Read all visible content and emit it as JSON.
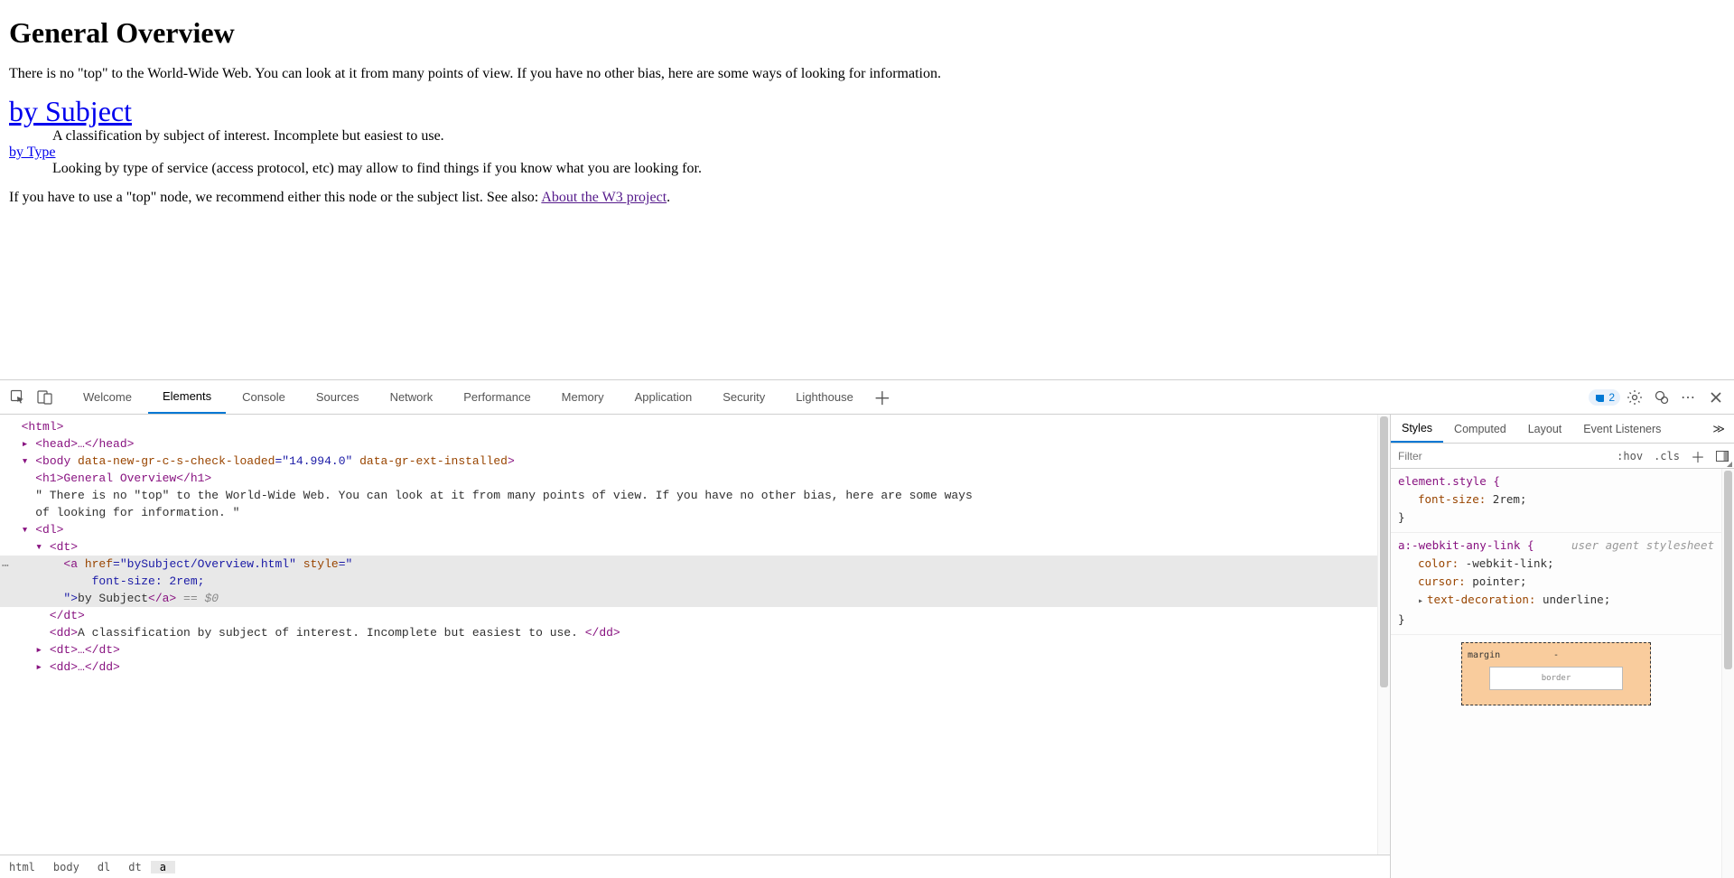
{
  "page": {
    "title": "General Overview",
    "intro": "There is no \"top\" to the World-Wide Web. You can look at it from many points of view. If you have no other bias, here are some ways of looking for information.",
    "subject_link": "by Subject",
    "subject_desc": "A classification by subject of interest. Incomplete but easiest to use.",
    "type_link": "by Type",
    "type_desc": "Looking by type of service (access protocol, etc) may allow to find things if you know what you are looking for.",
    "outro_prefix": "If you have to use a \"top\" node, we recommend either this node or the subject list. See also: ",
    "outro_link": "About the W3 project",
    "outro_suffix": "."
  },
  "devtools": {
    "tabs": [
      "Welcome",
      "Elements",
      "Console",
      "Sources",
      "Network",
      "Performance",
      "Memory",
      "Application",
      "Security",
      "Lighthouse"
    ],
    "active_tab": "Elements",
    "issue_count": "2",
    "styles_tabs": [
      "Styles",
      "Computed",
      "Layout",
      "Event Listeners"
    ],
    "styles_active": "Styles",
    "filter_placeholder": "Filter",
    "hov": ":hov",
    "cls": ".cls",
    "crumbs": [
      "html",
      "body",
      "dl",
      "dt",
      "a"
    ],
    "crumb_active": "a",
    "rules": {
      "elstyle_sel": "element.style {",
      "elstyle_font": "font-size:",
      "elstyle_font_val": " 2rem;",
      "anylink_sel": "a:-webkit-any-link {",
      "ua_label": "user agent stylesheet",
      "color_prop": "color:",
      "color_val": " -webkit-link;",
      "cursor_prop": "cursor:",
      "cursor_val": " pointer;",
      "textdec_prop": "text-decoration:",
      "textdec_val": " underline;",
      "close": "}"
    },
    "boxmodel": {
      "margin_label": "margin",
      "margin_top": "-",
      "border_label": "border"
    },
    "dom": {
      "l1": "<html>",
      "l2": "▸ <head>…</head>",
      "l3_open": "▾ <body ",
      "l3_a1n": "data-new-gr-c-s-check-loaded",
      "l3_a1v": "=\"14.994.0\" ",
      "l3_a2n": "data-gr-ext-installed",
      "l3_close": ">",
      "l4": "    <h1>General Overview</h1>",
      "l5": "    \" There is no \"top\" to the World-Wide Web. You can look at it from many points of view. If you have no other bias, here are some ways",
      "l5b": "    of looking for information. \"",
      "l6": "  ▾ <dl>",
      "l7": "    ▾ <dt>",
      "l8_open": "        <a ",
      "l8_hrefn": "href",
      "l8_hrefv": "=\"bySubject/Overview.html\" ",
      "l8_stylen": "style",
      "l8_stylev": "=\"",
      "l9": "            font-size: 2rem;",
      "l10_open": "        \">",
      "l10_text": "by Subject",
      "l10_close": "</a>",
      "l10_eq": " == $0",
      "l11": "      </dt>",
      "l12_open": "      <dd>",
      "l12_text": "A classification by subject of interest. Incomplete but easiest to use. ",
      "l12_close": "</dd>",
      "l13": "    ▸ <dt>…</dt>",
      "l14": "    ▸ <dd>…</dd>"
    }
  }
}
